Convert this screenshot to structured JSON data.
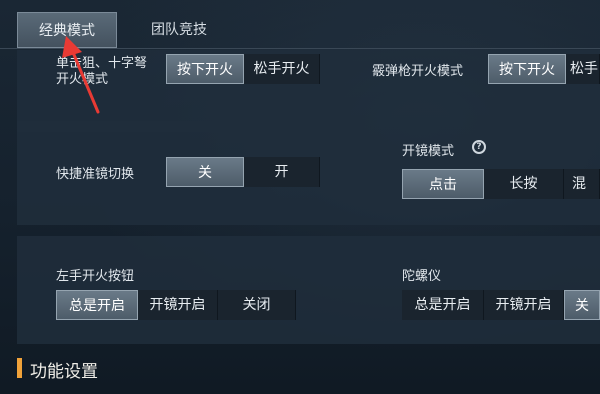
{
  "tabs": {
    "classic": "经典模式",
    "team": "团队竞技"
  },
  "row1": {
    "left_label_line1": "单击狙、十字弩",
    "left_label_line2": "开火模式",
    "left_options": [
      "按下开火",
      "松手开火"
    ],
    "right_label": "霰弹枪开火模式",
    "right_options": [
      "按下开火",
      "松手开"
    ]
  },
  "row2": {
    "left_label": "快捷准镜切换",
    "left_options": [
      "关",
      "开"
    ],
    "right_label": "开镜模式",
    "right_options": [
      "点击",
      "长按",
      "混"
    ]
  },
  "row3": {
    "left_label": "左手开火按钮",
    "left_options": [
      "总是开启",
      "开镜开启",
      "关闭"
    ],
    "right_label": "陀螺仪",
    "right_options": [
      "总是开启",
      "开镜开启",
      "关"
    ]
  },
  "section": {
    "title": "功能设置"
  },
  "colors": {
    "accent": "#f0a23a",
    "arrow": "#e83a34"
  }
}
